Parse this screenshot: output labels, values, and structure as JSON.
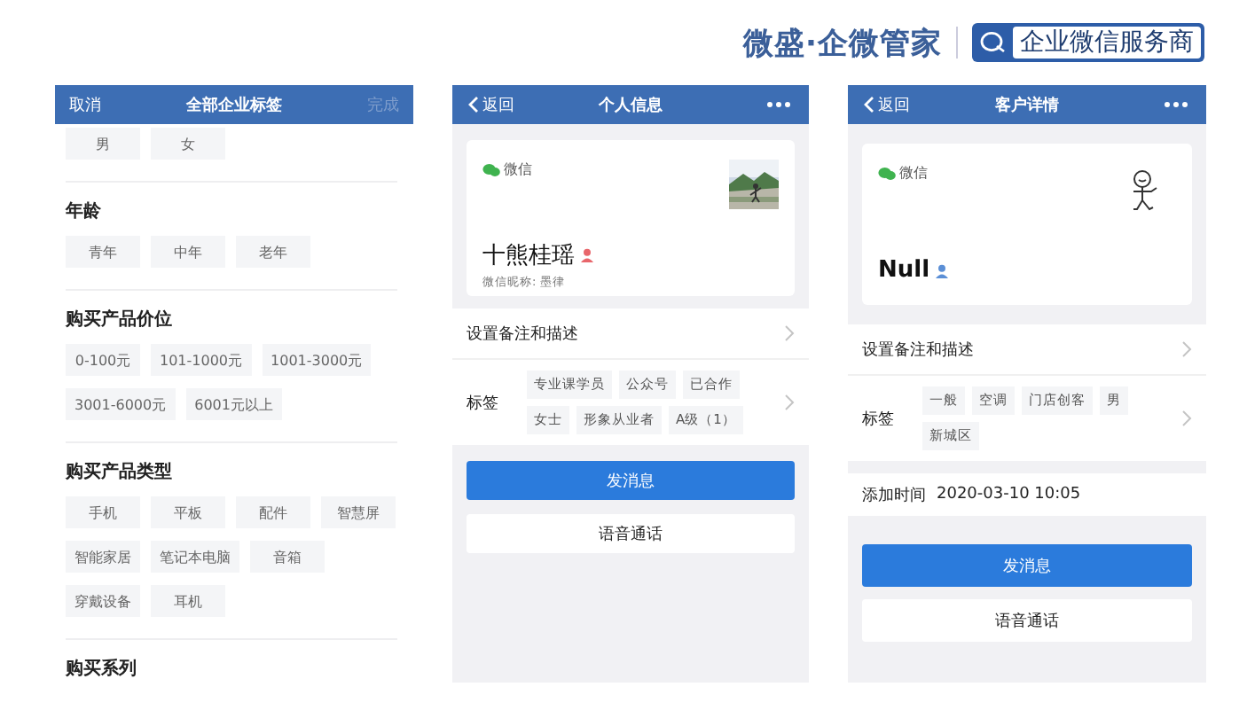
{
  "brand": {
    "name": "微盛·企微管家",
    "badge": "企业微信服务商"
  },
  "screens": [
    {
      "kind": "tag_picker",
      "header": {
        "left": "取消",
        "title": "全部企业标签",
        "action": {
          "label": "完成",
          "disabled": true
        }
      },
      "groups": [
        {
          "tags": [
            "男",
            "女"
          ]
        },
        {
          "title": "年龄",
          "tags": [
            "青年",
            "中年",
            "老年"
          ]
        },
        {
          "title": "购买产品价位",
          "tags": [
            "0-100元",
            "101-1000元",
            "1001-3000元",
            "3001-6000元",
            "6001元以上"
          ]
        },
        {
          "title": "购买产品类型",
          "tags": [
            "手机",
            "平板",
            "配件",
            "智慧屏",
            "智能家居",
            "笔记本电脑",
            "音箱",
            "穿戴设备",
            "耳机"
          ]
        },
        {
          "title": "购买系列"
        }
      ]
    },
    {
      "kind": "profile",
      "header": {
        "back": "返回",
        "title": "个人信息"
      },
      "card": {
        "source": "微信",
        "name": "十熊桂瑶",
        "person_icon": {
          "color": "#e8666b"
        },
        "nickname": "微信昵称: 墨律"
      },
      "rows": [
        {
          "kind": "link",
          "label": "设置备注和描述"
        },
        {
          "kind": "tags",
          "label": "标签",
          "tags": [
            "专业课学员",
            "公众号",
            "已合作",
            "女士",
            "形象从业者",
            "A级（1）"
          ]
        }
      ],
      "buttons": [
        {
          "label": "发消息",
          "primary": true
        },
        {
          "label": "语音通话",
          "primary": false
        }
      ]
    },
    {
      "kind": "profile",
      "header": {
        "back": "返回",
        "title": "客户详情"
      },
      "card": {
        "source": "微信",
        "name": "Null",
        "person_icon": {
          "color": "#5b8fd6"
        },
        "avatar": {
          "kind": "doodle"
        }
      },
      "rows": [
        {
          "kind": "link",
          "label": "设置备注和描述"
        },
        {
          "kind": "tags",
          "label": "标签",
          "tags": [
            "一般",
            "空调",
            "门店创客",
            "男",
            "新城区"
          ]
        },
        {
          "kind": "info",
          "label": "添加时间",
          "value": "2020-03-10 10:05"
        }
      ],
      "buttons": [
        {
          "label": "发消息",
          "primary": true
        },
        {
          "label": "语音通话",
          "primary": false
        }
      ]
    }
  ]
}
